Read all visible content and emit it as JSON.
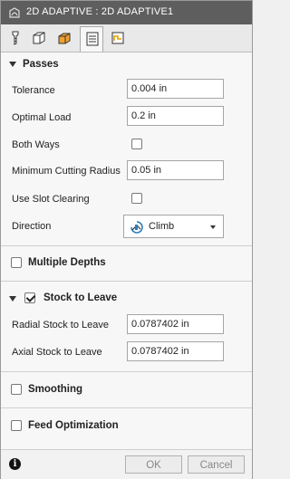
{
  "window": {
    "title": "2D ADAPTIVE : 2D ADAPTIVE1"
  },
  "tabs": [
    {
      "icon": "tool-icon",
      "active": false
    },
    {
      "icon": "geometry-icon",
      "active": false
    },
    {
      "icon": "heights-icon",
      "active": false
    },
    {
      "icon": "passes-icon",
      "active": true
    },
    {
      "icon": "linking-icon",
      "active": false
    }
  ],
  "passes": {
    "header": "Passes",
    "tolerance_label": "Tolerance",
    "tolerance_value": "0.004 in",
    "optimal_load_label": "Optimal Load",
    "optimal_load_value": "0.2 in",
    "both_ways_label": "Both Ways",
    "both_ways_checked": false,
    "min_radius_label": "Minimum Cutting Radius",
    "min_radius_value": "0.05 in",
    "slot_clearing_label": "Use Slot Clearing",
    "slot_clearing_checked": false,
    "direction_label": "Direction",
    "direction_value": "Climb"
  },
  "multiple_depths": {
    "header": "Multiple Depths",
    "checked": false
  },
  "stock_to_leave": {
    "header": "Stock to Leave",
    "checked": true,
    "radial_label": "Radial Stock to Leave",
    "radial_value": "0.0787402 in",
    "axial_label": "Axial Stock to Leave",
    "axial_value": "0.0787402 in"
  },
  "smoothing": {
    "header": "Smoothing",
    "checked": false
  },
  "feed_optimization": {
    "header": "Feed Optimization",
    "checked": false
  },
  "footer": {
    "ok_label": "OK",
    "cancel_label": "Cancel"
  },
  "colors": {
    "titlebar": "#5e5e5e",
    "dialog_bg": "#f7f7f7",
    "input_border": "#a5a5a5"
  }
}
